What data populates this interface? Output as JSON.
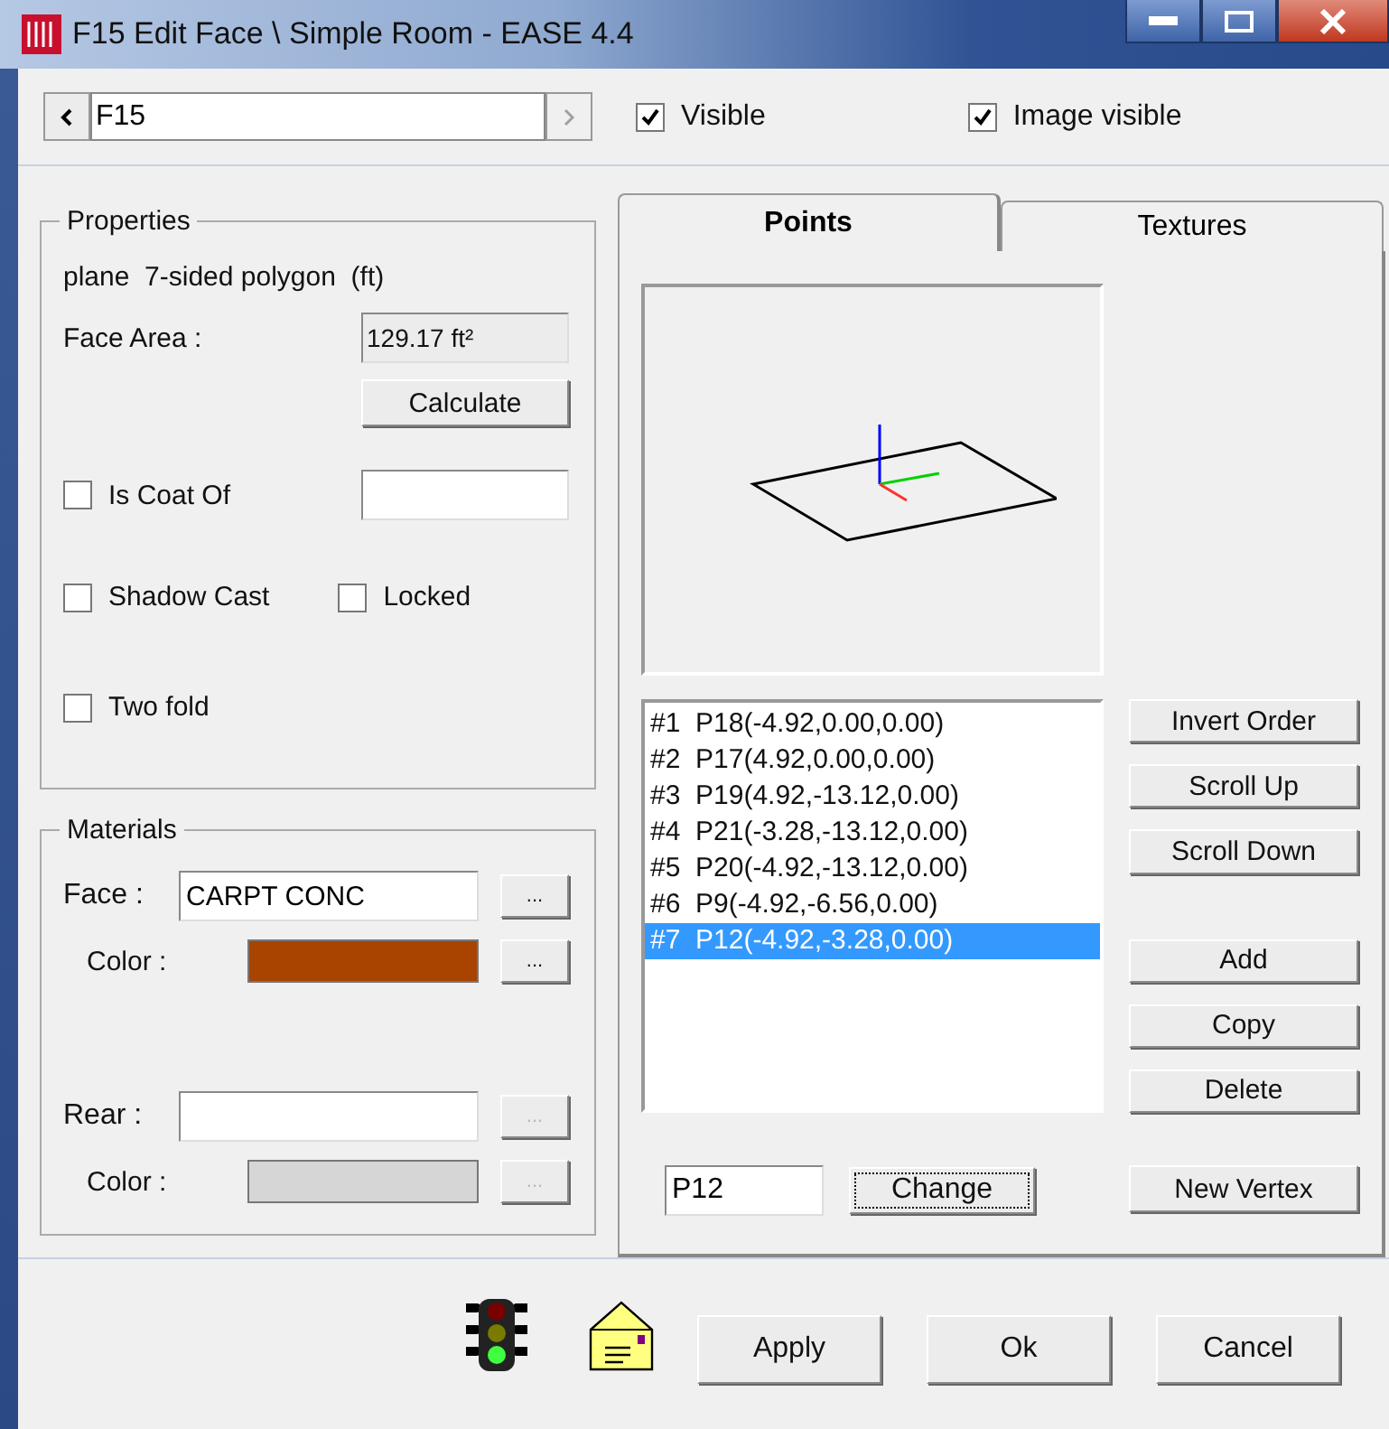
{
  "window": {
    "title": "F15 Edit Face \\ Simple Room - EASE 4.4"
  },
  "navigator": {
    "value": "F15",
    "next_disabled": true
  },
  "top_checks": [
    {
      "label": "Visible",
      "checked": true
    },
    {
      "label": "Image visible",
      "checked": true
    }
  ],
  "properties": {
    "title": "Properties",
    "description": "plane  7-sided polygon  (ft)",
    "face_area_label": "Face Area :",
    "face_area_value": "129.17 ft²",
    "calculate": "Calculate",
    "is_coat_of": {
      "label": "Is Coat Of",
      "checked": false
    },
    "shadow_cast": {
      "label": "Shadow Cast",
      "checked": false
    },
    "locked": {
      "label": "Locked",
      "checked": false
    },
    "two_fold": {
      "label": "Two fold",
      "checked": false
    }
  },
  "materials": {
    "title": "Materials",
    "rows": [
      {
        "label": "Face :",
        "value": "CARPT CONC",
        "browse": "...",
        "color_label": "Color :",
        "color": "#a84400",
        "color_browse": "...",
        "disabled": false
      },
      {
        "label": "Rear :",
        "browse": "...",
        "color_label": "Color :",
        "color": "#d6d6d6",
        "color_browse": "...",
        "disabled": true
      }
    ]
  },
  "tabs": [
    {
      "label": "Points",
      "selected": true
    },
    {
      "label": "Textures",
      "selected": false
    }
  ],
  "points": [
    {
      "index": "#1",
      "text": "P18(-4.92,0.00,0.00)",
      "selected": false
    },
    {
      "index": "#2",
      "text": "P17(4.92,0.00,0.00)",
      "selected": false
    },
    {
      "index": "#3",
      "text": "P19(4.92,-13.12,0.00)",
      "selected": false
    },
    {
      "index": "#4",
      "text": "P21(-3.28,-13.12,0.00)",
      "selected": false
    },
    {
      "index": "#5",
      "text": "P20(-4.92,-13.12,0.00)",
      "selected": false
    },
    {
      "index": "#6",
      "text": "P9(-4.92,-6.56,0.00)",
      "selected": false
    },
    {
      "index": "#7",
      "text": "P12(-4.92,-3.28,0.00)",
      "selected": true
    }
  ],
  "order_buttons": [
    "Invert Order",
    "Scroll Up",
    "Scroll Down"
  ],
  "edit_buttons": [
    "Add",
    "Copy",
    "Delete"
  ],
  "point_name": "P12",
  "change": "Change",
  "new_vertex": "New Vertex",
  "footer_buttons": [
    "Apply",
    "Ok",
    "Cancel"
  ]
}
